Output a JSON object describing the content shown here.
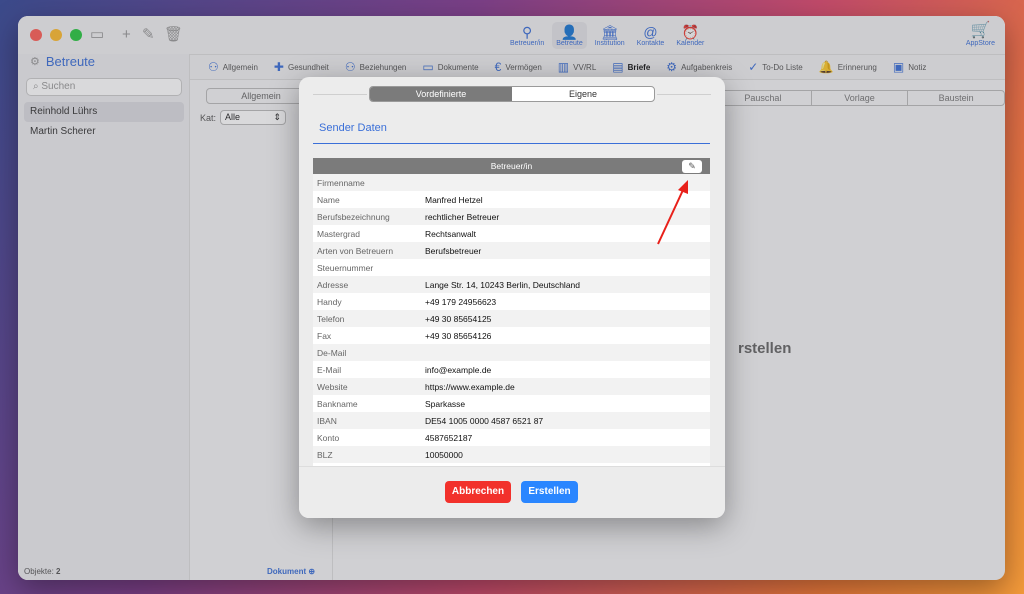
{
  "toolbar": {
    "nav": [
      {
        "label": "Betreuer/in",
        "icon": "person-tie-icon"
      },
      {
        "label": "Betreute",
        "icon": "person-icon"
      },
      {
        "label": "Institution",
        "icon": "building-icon"
      },
      {
        "label": "Kontakte",
        "icon": "contact-card-icon"
      },
      {
        "label": "Kalender",
        "icon": "alarm-clock-icon"
      }
    ],
    "appstore_label": "AppStore"
  },
  "section_tabs": [
    "Allgemein",
    "Gesundheit",
    "Beziehungen",
    "Dokumente",
    "Vermögen",
    "VV/RL",
    "Briefe",
    "Aufgabenkreis",
    "To-Do Liste",
    "Erinnerung",
    "Notiz"
  ],
  "sidebar": {
    "title": "Betreute",
    "search_placeholder": "Suchen",
    "items": [
      "Reinhold Lührs",
      "Martin Scherer"
    ],
    "footer_label": "Objekte:",
    "footer_count": "2"
  },
  "midpane": {
    "segment_label": "Allgemein",
    "kat_label": "Kat:",
    "kat_value": "Alle",
    "dokument_label": "Dokument"
  },
  "right_segments": [
    "Pauschal",
    "Vorlage",
    "Baustein"
  ],
  "background_text": "rstellen",
  "modal": {
    "segments": [
      "Vordefinierte",
      "Eigene"
    ],
    "sender_title": "Sender Daten",
    "table_header": "Betreuer/in",
    "rows": [
      {
        "key": "Firmenname",
        "value": ""
      },
      {
        "key": "Name",
        "value": "Manfred Hetzel"
      },
      {
        "key": "Berufsbezeichnung",
        "value": "rechtlicher Betreuer"
      },
      {
        "key": "Mastergrad",
        "value": "Rechtsanwalt"
      },
      {
        "key": "Arten von Betreuern",
        "value": "Berufsbetreuer"
      },
      {
        "key": "Steuernummer",
        "value": ""
      },
      {
        "key": "Adresse",
        "value": "Lange Str. 14, 10243 Berlin, Deutschland"
      },
      {
        "key": "Handy",
        "value": "+49 179 24956623"
      },
      {
        "key": "Telefon",
        "value": "+49 30 85654125"
      },
      {
        "key": "Fax",
        "value": "+49 30 85654126"
      },
      {
        "key": "De-Mail",
        "value": ""
      },
      {
        "key": "E-Mail",
        "value": "info@example.de"
      },
      {
        "key": "Website",
        "value": "https://www.example.de"
      },
      {
        "key": "Bankname",
        "value": "Sparkasse"
      },
      {
        "key": "IBAN",
        "value": "DE54 1005 0000 4587 6521 87"
      },
      {
        "key": "Konto",
        "value": "4587652187"
      },
      {
        "key": "BLZ",
        "value": "10050000"
      }
    ],
    "cancel_label": "Abbrechen",
    "create_label": "Erstellen"
  },
  "colors": {
    "accent": "#3a6fd8",
    "cancel": "#f2312b",
    "create": "#2a86ff",
    "arrow": "#e8201a"
  }
}
